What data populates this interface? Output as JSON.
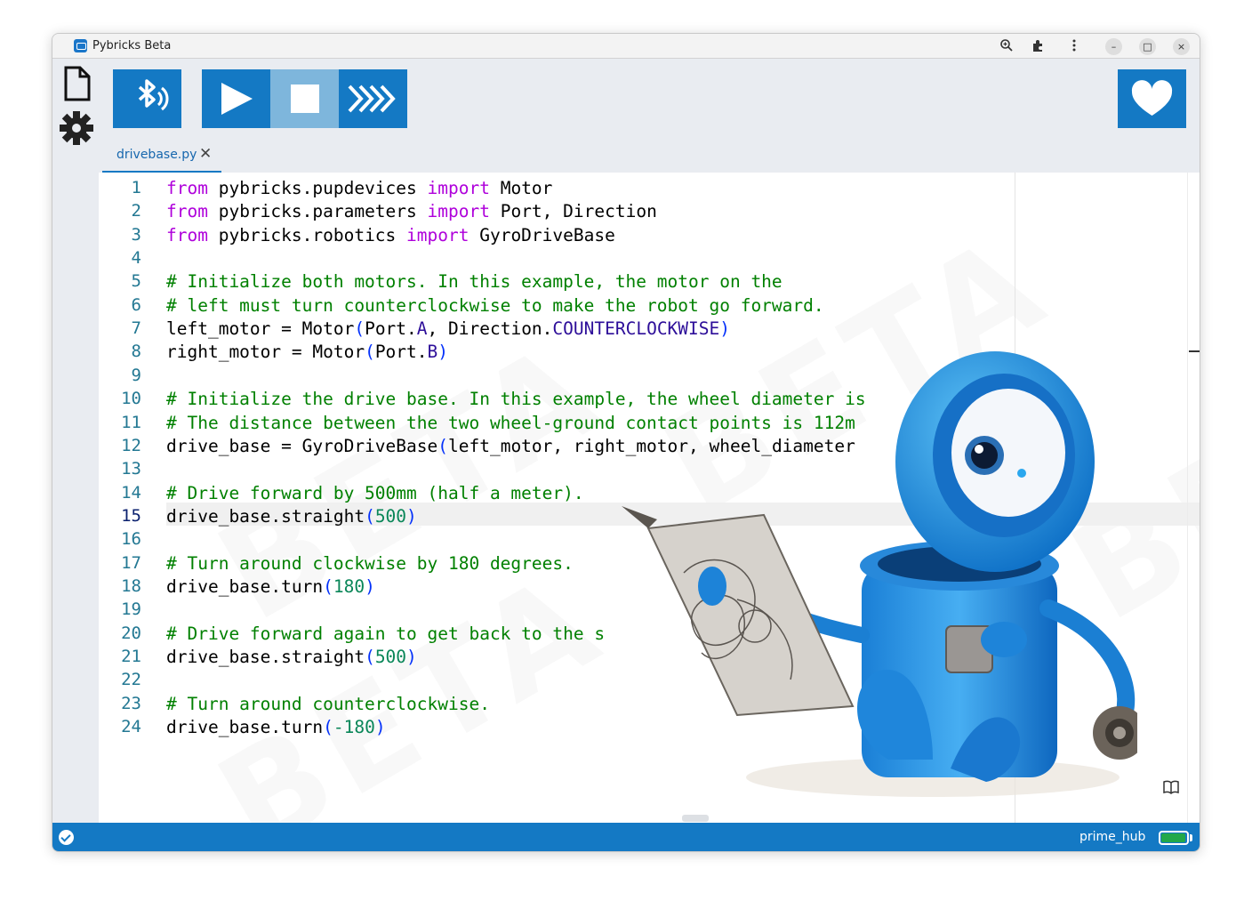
{
  "window": {
    "title": "Pybricks Beta"
  },
  "titlebar": {
    "icons": [
      "zoom-icon",
      "extensions-icon",
      "more-icon"
    ],
    "controls": {
      "minimize": "–",
      "maximize": "□",
      "close": "×"
    }
  },
  "sidebar": {
    "items": [
      "file-icon",
      "gear-icon"
    ]
  },
  "toolbar": {
    "buttons": [
      "bluetooth-icon",
      "run-icon",
      "stop-icon",
      "repl-icon"
    ],
    "sponsor": "heart-icon"
  },
  "tabs": [
    {
      "label": "drivebase.py",
      "close": "✕"
    }
  ],
  "editor": {
    "active_line": 15,
    "line_numbers": [
      "1",
      "2",
      "3",
      "4",
      "5",
      "6",
      "7",
      "8",
      "9",
      "10",
      "11",
      "12",
      "13",
      "14",
      "15",
      "16",
      "17",
      "18",
      "19",
      "20",
      "21",
      "22",
      "23",
      "24"
    ],
    "watermark": "BETA",
    "lines": [
      [
        {
          "t": "from",
          "c": "k"
        },
        {
          "t": " pybricks.pupdevices "
        },
        {
          "t": "import",
          "c": "k"
        },
        {
          "t": " Motor"
        }
      ],
      [
        {
          "t": "from",
          "c": "k"
        },
        {
          "t": " pybricks.parameters "
        },
        {
          "t": "import",
          "c": "k"
        },
        {
          "t": " Port, Direction"
        }
      ],
      [
        {
          "t": "from",
          "c": "k"
        },
        {
          "t": " pybricks.robotics "
        },
        {
          "t": "import",
          "c": "k"
        },
        {
          "t": " GyroDriveBase"
        }
      ],
      [],
      [
        {
          "t": "# Initialize both motors. In this example, the motor on the",
          "c": "c"
        }
      ],
      [
        {
          "t": "# left must turn counterclockwise to make the robot go forward.",
          "c": "c"
        }
      ],
      [
        {
          "t": "left_motor = Motor"
        },
        {
          "t": "(",
          "c": "bl"
        },
        {
          "t": "Port."
        },
        {
          "t": "A",
          "c": "enum"
        },
        {
          "t": ", Direction."
        },
        {
          "t": "COUNTERCLOCKWISE",
          "c": "enum"
        },
        {
          "t": ")",
          "c": "bl"
        }
      ],
      [
        {
          "t": "right_motor = Motor"
        },
        {
          "t": "(",
          "c": "bl"
        },
        {
          "t": "Port."
        },
        {
          "t": "B",
          "c": "enum"
        },
        {
          "t": ")",
          "c": "bl"
        }
      ],
      [],
      [
        {
          "t": "# Initialize the drive base. In this example, the wheel diameter is",
          "c": "c"
        }
      ],
      [
        {
          "t": "# The distance between the two wheel-ground contact points is 112m",
          "c": "c"
        }
      ],
      [
        {
          "t": "drive_base = GyroDriveBase"
        },
        {
          "t": "(",
          "c": "bl"
        },
        {
          "t": "left_motor, right_motor, wheel_diameter"
        }
      ],
      [],
      [
        {
          "t": "# Drive forward by 500mm (half a meter).",
          "c": "c"
        }
      ],
      [
        {
          "t": "drive_base.straight"
        },
        {
          "t": "(",
          "c": "bl"
        },
        {
          "t": "500",
          "c": "num"
        },
        {
          "t": ")",
          "c": "bl"
        }
      ],
      [],
      [
        {
          "t": "# Turn around clockwise by 180 degrees.",
          "c": "c"
        }
      ],
      [
        {
          "t": "drive_base.turn"
        },
        {
          "t": "(",
          "c": "bl"
        },
        {
          "t": "180",
          "c": "num"
        },
        {
          "t": ")",
          "c": "bl"
        }
      ],
      [],
      [
        {
          "t": "# Drive forward again to get back to the s",
          "c": "c"
        }
      ],
      [
        {
          "t": "drive_base.straight"
        },
        {
          "t": "(",
          "c": "bl"
        },
        {
          "t": "500",
          "c": "num"
        },
        {
          "t": ")",
          "c": "bl"
        }
      ],
      [],
      [
        {
          "t": "# Turn around counterclockwise.",
          "c": "c"
        }
      ],
      [
        {
          "t": "drive_base.turn"
        },
        {
          "t": "(",
          "c": "bl"
        },
        {
          "t": "-180",
          "c": "num"
        },
        {
          "t": ")",
          "c": "bl"
        }
      ]
    ]
  },
  "statusbar": {
    "status_icon": "check-circle-icon",
    "hub_name": "prime_hub",
    "battery_level": 0.95,
    "battery_color": "#22a84a"
  },
  "colors": {
    "accent": "#1479c4",
    "stop_button": "#7eb6dc",
    "keyword": "#af00db",
    "comment": "#008000",
    "number": "#098658"
  }
}
